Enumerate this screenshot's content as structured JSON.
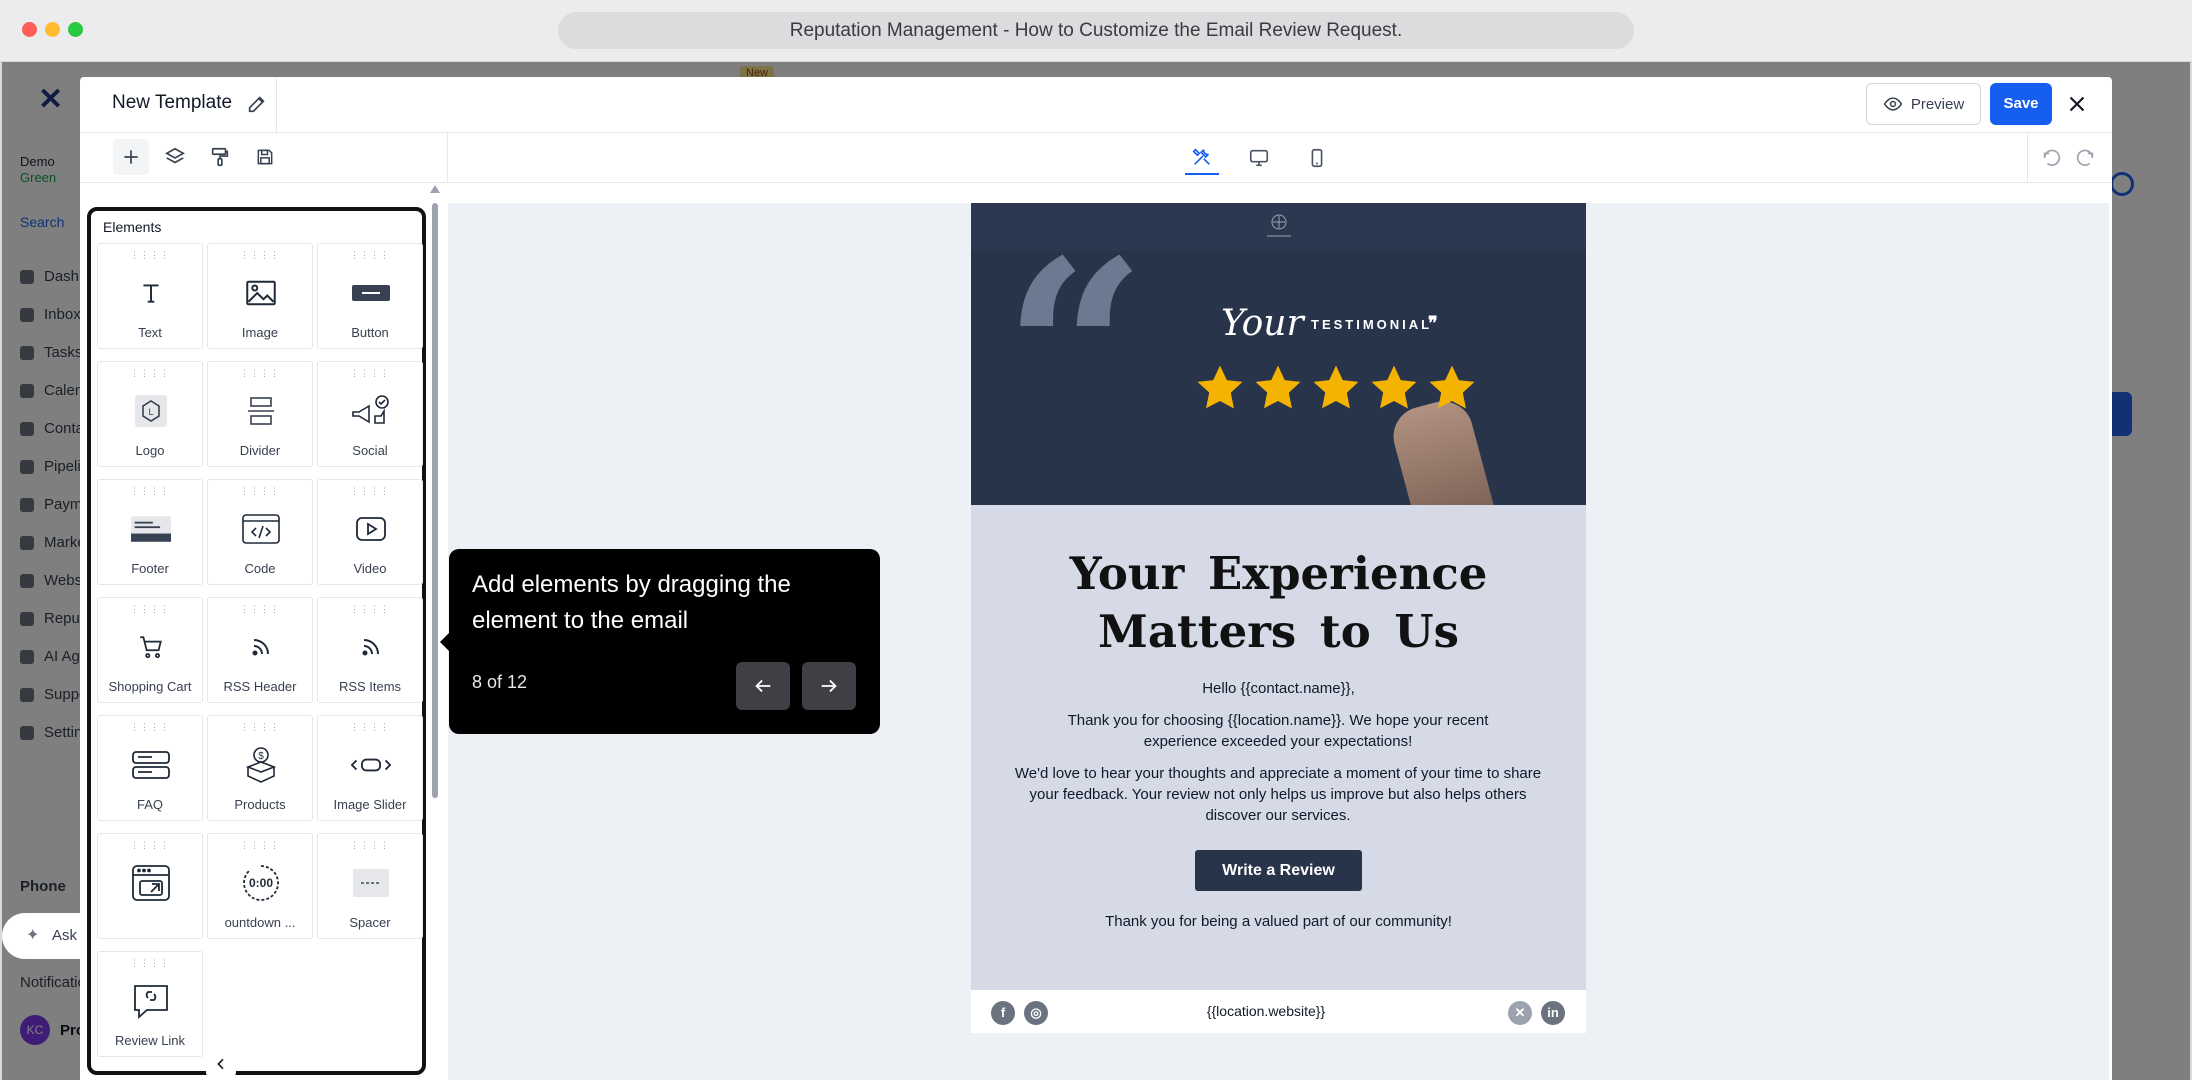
{
  "window": {
    "title": "Reputation Management - How to Customize the Email Review Request."
  },
  "background_app": {
    "location": {
      "name": "Demo",
      "sub": "Green"
    },
    "search_label": "Search",
    "new_badge": "New",
    "sidebar": [
      "Dashboard",
      "Inbox",
      "Tasks",
      "Calendar",
      "Contacts",
      "Pipelines",
      "Payments",
      "Marketing",
      "Websites",
      "Reputation",
      "AI Agents",
      "Support",
      "Settings"
    ],
    "phone_label": "Phone",
    "ask_ai_label": "Ask AI",
    "notifications_label": "Notifications",
    "avatar_initials": "KC",
    "profile_label": "Profile"
  },
  "editor": {
    "template_title": "New Template",
    "preview_label": "Preview",
    "save_label": "Save",
    "panel_title": "Elements",
    "elements": [
      {
        "label": "Text",
        "icon": "text-icon"
      },
      {
        "label": "Image",
        "icon": "image-icon"
      },
      {
        "label": "Button",
        "icon": "button-icon"
      },
      {
        "label": "Logo",
        "icon": "logo-icon"
      },
      {
        "label": "Divider",
        "icon": "divider-icon"
      },
      {
        "label": "Social",
        "icon": "social-icon"
      },
      {
        "label": "Footer",
        "icon": "footer-icon"
      },
      {
        "label": "Code",
        "icon": "code-icon"
      },
      {
        "label": "Video",
        "icon": "video-icon"
      },
      {
        "label": "Shopping Cart",
        "icon": "cart-icon"
      },
      {
        "label": "RSS Header",
        "icon": "rss-icon"
      },
      {
        "label": "RSS Items",
        "icon": "rss-icon"
      },
      {
        "label": "FAQ",
        "icon": "faq-icon"
      },
      {
        "label": "Products",
        "icon": "products-icon"
      },
      {
        "label": "Image Slider",
        "icon": "slider-icon"
      },
      {
        "label": "",
        "icon": "embed-icon"
      },
      {
        "label": "ountdown ...",
        "icon": "countdown-icon"
      },
      {
        "label": "Spacer",
        "icon": "spacer-icon"
      },
      {
        "label": "Review Link",
        "icon": "review-link-icon"
      }
    ],
    "countdown_display": "0:00"
  },
  "email": {
    "hero_script": "Your",
    "hero_word": "TESTIMONIAL",
    "headline_line1": "Your Experience",
    "headline_line2": "Matters to Us",
    "greeting": "Hello {{contact.name}},",
    "paragraph1": "Thank you for choosing {{location.name}}. We hope your recent experience exceeded your expectations!",
    "paragraph2": "We'd love to hear your thoughts and appreciate a moment of your time to share your feedback. Your review not only helps us improve but also helps others discover our services.",
    "cta_label": "Write a Review",
    "closing": "Thank you for being a valued part of our community!",
    "footer_website": "{{location.website}}",
    "star_color": "#f5b301"
  },
  "tour": {
    "message": "Add elements by dragging the element to the email",
    "step": "8 of 12"
  }
}
